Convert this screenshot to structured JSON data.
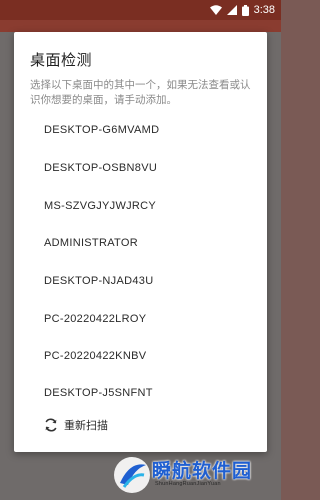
{
  "status_bar": {
    "time": "3:38",
    "icons": [
      "wifi-icon",
      "cellular-signal-icon",
      "battery-icon"
    ]
  },
  "dialog": {
    "title": "桌面检测",
    "message": "选择以下桌面中的其中一个，如果无法查看或认识你想要的桌面，请手动添加。",
    "items": [
      "DESKTOP-G6MVAMD",
      "DESKTOP-OSBN8VU",
      "MS-SZVGJYJWJRCY",
      "ADMINISTRATOR",
      "DESKTOP-NJAD43U",
      "PC-20220422LROY",
      "PC-20220422KNBV",
      "DESKTOP-J5SNFNT"
    ],
    "rescan_label": "重新扫描",
    "rescan_icon": "refresh-icon"
  },
  "watermark": {
    "title": "瞬航软件园",
    "subtitle": "ShunHangRuanJianYuan"
  },
  "colors": {
    "status_bar": "#7a2e22",
    "dialog_bg": "#ffffff",
    "message_text": "#8a8a8a",
    "watermark_text": "#1f5fd1"
  }
}
